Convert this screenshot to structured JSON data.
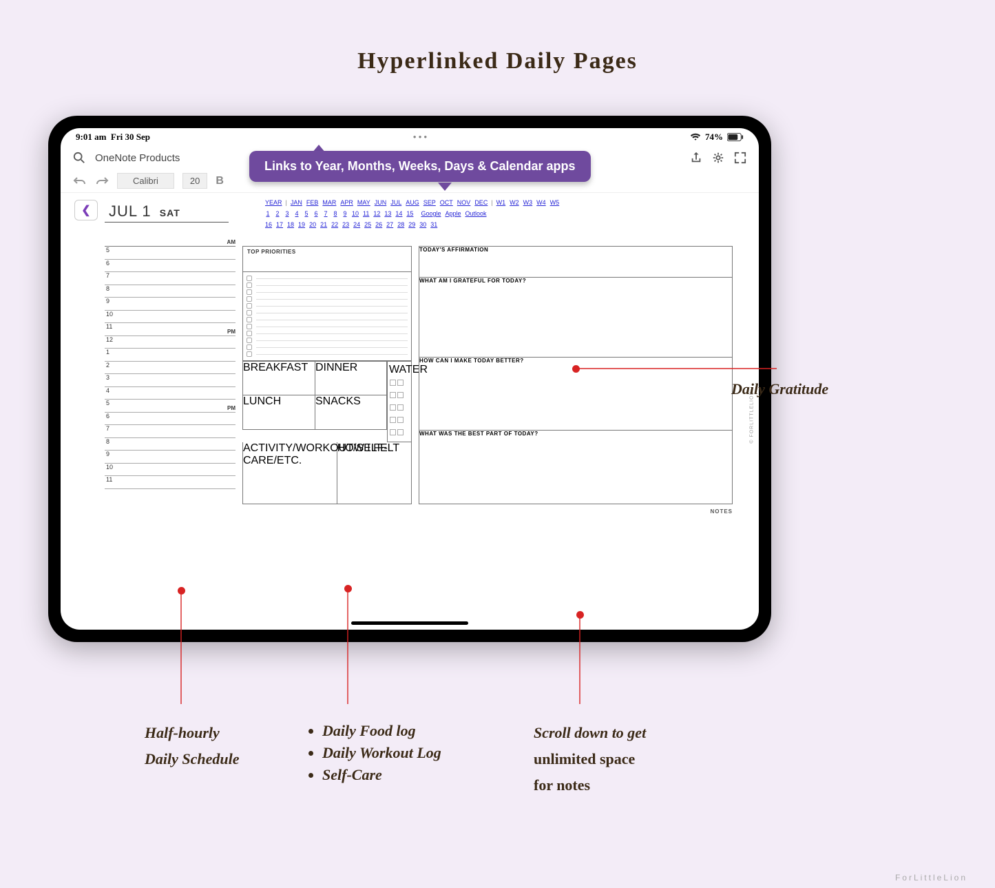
{
  "title": "Hyperlinked Daily Pages",
  "statusbar": {
    "time": "9:01 am",
    "date": "Fri 30 Sep",
    "battery": "74%"
  },
  "app": {
    "search": "OneNote Products",
    "font": "Calibri",
    "size": "20"
  },
  "doc": {
    "month": "JUL 1",
    "day": "SAT"
  },
  "links": {
    "periods": [
      "YEAR",
      "JAN",
      "FEB",
      "MAR",
      "APR",
      "MAY",
      "JUN",
      "JUL",
      "AUG",
      "SEP",
      "OCT",
      "NOV",
      "DEC"
    ],
    "weeks": [
      "W1",
      "W2",
      "W3",
      "W4",
      "W5"
    ],
    "days1": [
      "1",
      "2",
      "3",
      "4",
      "5",
      "6",
      "7",
      "8",
      "9",
      "10",
      "11",
      "12",
      "13",
      "14",
      "15"
    ],
    "apps": [
      "Google",
      "Apple",
      "Outlook"
    ],
    "days2": [
      "16",
      "17",
      "18",
      "19",
      "20",
      "21",
      "22",
      "23",
      "24",
      "25",
      "26",
      "27",
      "28",
      "29",
      "30",
      "31"
    ]
  },
  "schedule": {
    "am": [
      "5",
      "6",
      "7",
      "8",
      "9",
      "10",
      "11"
    ],
    "pm1": [
      "12",
      "1",
      "2",
      "3",
      "4",
      "5"
    ],
    "pm2": [
      "6",
      "7",
      "8",
      "9",
      "10",
      "11"
    ]
  },
  "labels": {
    "top": "TOP PRIORITIES",
    "aff": "TODAY'S AFFIRMATION",
    "grate": "WHAT AM I GRATEFUL FOR TODAY?",
    "better": "HOW CAN I MAKE TODAY BETTER?",
    "best": "WHAT WAS THE BEST PART OF TODAY?",
    "bf": "BREAKFAST",
    "din": "DINNER",
    "lun": "LUNCH",
    "sn": "SNACKS",
    "water": "WATER",
    "act": "ACTIVITY/WORKOUT/SELF-CARE/ETC.",
    "felt": "HOW I FELT",
    "notes": "NOTES"
  },
  "pill": "Links to Year, Months, Weeks, Days & Calendar apps",
  "callouts": {
    "sched1": "Half-hourly",
    "sched2": "Daily Schedule",
    "food": "Daily Food log",
    "work": "Daily Workout Log",
    "care": "Self-Care",
    "grat": "Daily Gratitude",
    "notes1": "Scroll down to get",
    "notes2": "unlimited space",
    "notes3": "for notes"
  },
  "credit": "ForLittleLion"
}
